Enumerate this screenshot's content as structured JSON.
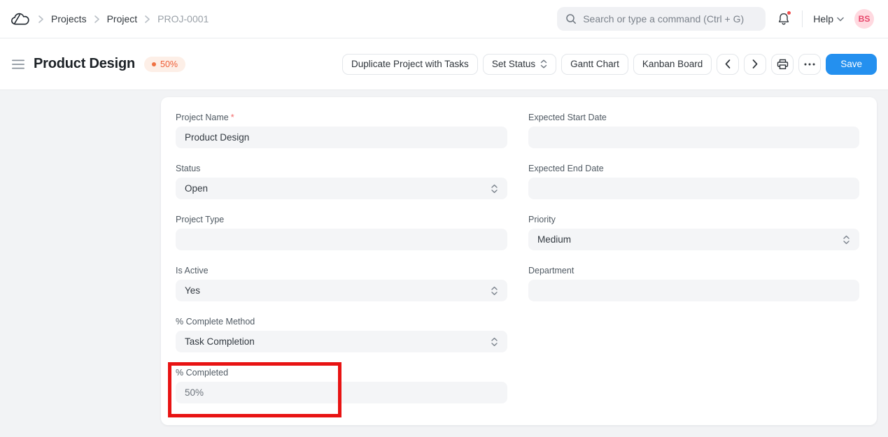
{
  "navbar": {
    "breadcrumb": {
      "items": [
        "Projects",
        "Project",
        "PROJ-0001"
      ]
    },
    "search": {
      "placeholder": "Search or type a command (Ctrl + G)"
    },
    "help_label": "Help",
    "avatar": {
      "initials": "BS"
    }
  },
  "header": {
    "title": "Product Design",
    "badge": {
      "value": "50%"
    },
    "toolbar": {
      "duplicate": "Duplicate Project with Tasks",
      "set_status": "Set Status",
      "gantt": "Gantt Chart",
      "kanban": "Kanban Board",
      "ellipsis": "···",
      "save": "Save"
    }
  },
  "form": {
    "left": [
      {
        "label": "Project Name",
        "required_mark": "*",
        "value": "Product Design",
        "type": "input"
      },
      {
        "label": "Status",
        "value": "Open",
        "type": "select"
      },
      {
        "label": "Project Type",
        "value": "",
        "type": "input"
      },
      {
        "label": "Is Active",
        "value": "Yes",
        "type": "select"
      },
      {
        "label": "% Complete Method",
        "value": "Task Completion",
        "type": "select"
      },
      {
        "label": "% Completed",
        "value": "50%",
        "type": "input"
      }
    ],
    "right": [
      {
        "label": "Expected Start Date",
        "value": "",
        "type": "input"
      },
      {
        "label": "Expected End Date",
        "value": "",
        "type": "input"
      },
      {
        "label": "Priority",
        "value": "Medium",
        "type": "select"
      },
      {
        "label": "Department",
        "value": "",
        "type": "input"
      }
    ]
  },
  "colors": {
    "accent_blue": "#2490ef",
    "badge_text_orange": "#ee5e37",
    "badge_bg": "#fdefe7",
    "annotation_red": "#e81313",
    "avatar_bg": "#ffd9e0",
    "avatar_text": "#e7476b",
    "notification_dot": "#f14b4b"
  },
  "icons": {
    "logo": "cloud-with-slash",
    "breadcrumb_separator": "chevron-right",
    "search": "magnifier",
    "bell": "notification-bell",
    "help_caret": "chevron-down",
    "menu": "hamburger",
    "select_caret": "up-down-chevrons",
    "prev": "chevron-left",
    "next": "chevron-right",
    "print": "printer",
    "more": "ellipsis"
  }
}
